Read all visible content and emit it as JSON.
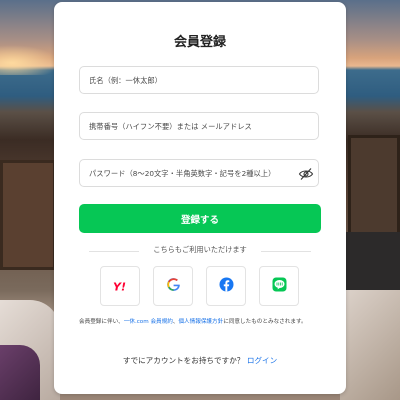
{
  "form": {
    "title": "会員登録",
    "name_placeholder": "氏名（例：一休太郎）",
    "contact_placeholder": "携帯番号（ハイフン不要）または メールアドレス",
    "password_placeholder": "パスワード（8〜20文字・半角英数字・記号を2種以上）",
    "submit_label": "登録する"
  },
  "social": {
    "heading": "こちらもご利用いただけます",
    "providers": [
      "yahoo-icon",
      "google-icon",
      "facebook-icon",
      "line-icon"
    ]
  },
  "terms": {
    "prefix": "会員登録に伴い、",
    "link1": "一休.com 会員規約",
    "sep": "、",
    "link2": "個人情報保護方針",
    "suffix": "に同意したものとみなされます。"
  },
  "footer": {
    "question": "すでにアカウントをお持ちですか？",
    "login_link": "ログイン"
  },
  "colors": {
    "primary": "#06c755",
    "link": "#1a73e8",
    "facebook": "#1877f2",
    "line": "#06c755",
    "yahoo": "#ff0033"
  }
}
